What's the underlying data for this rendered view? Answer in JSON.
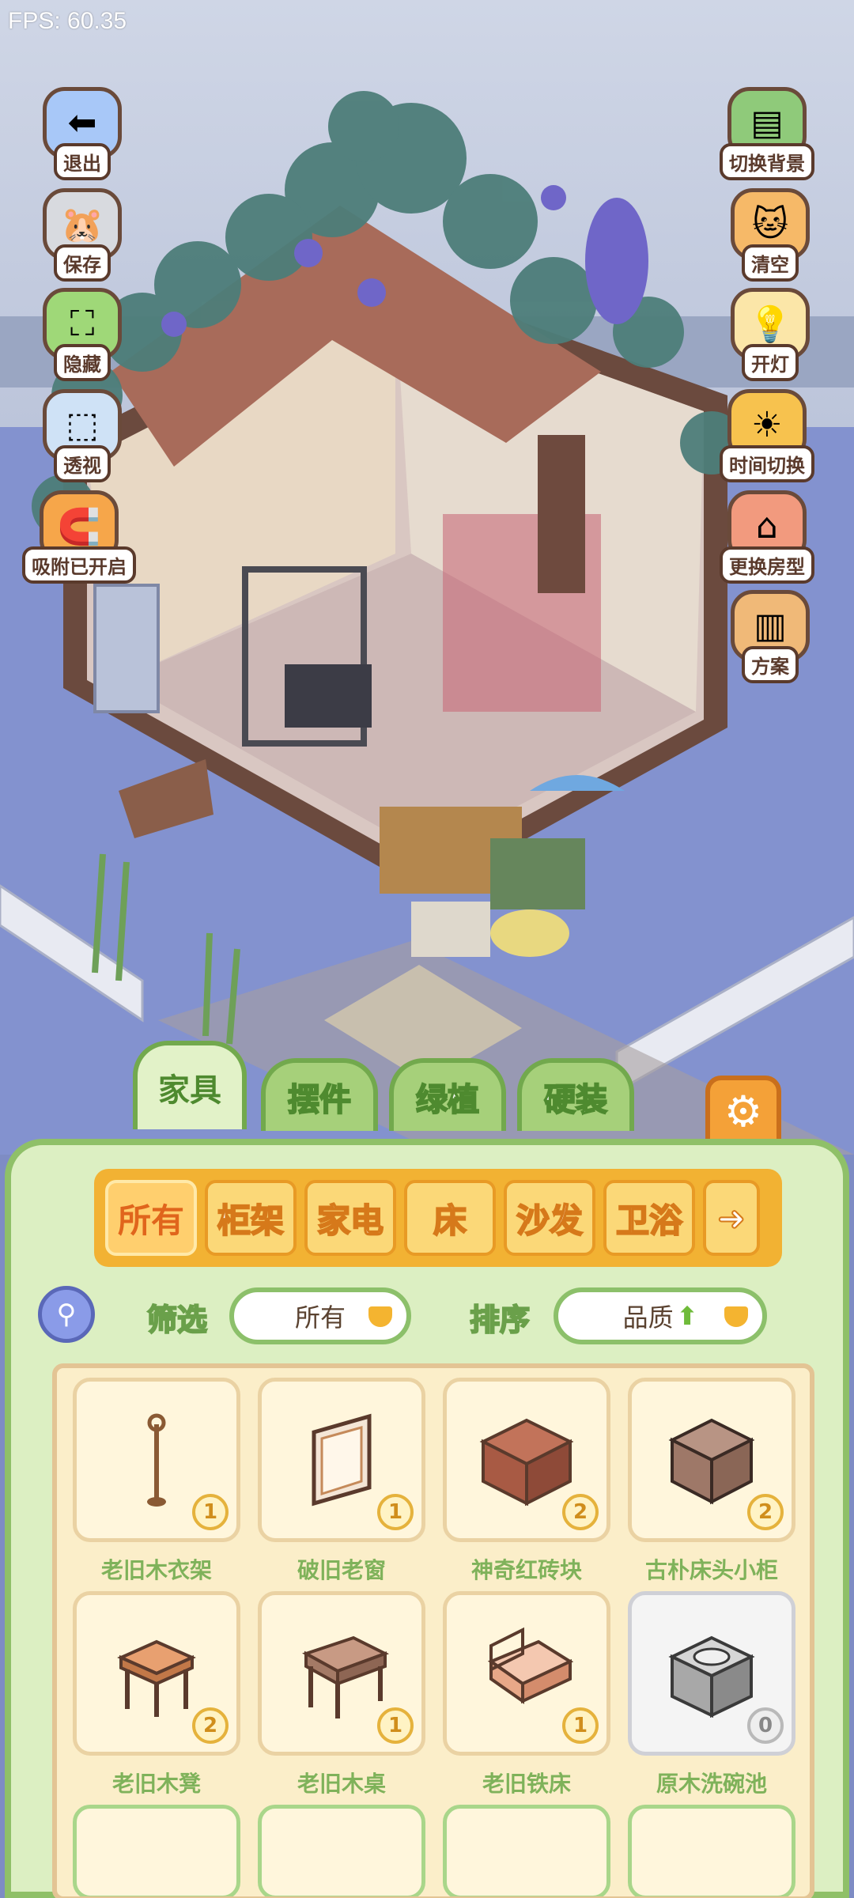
{
  "fps": "FPS: 60.35",
  "left_buttons": [
    {
      "label": "退出",
      "icon": "exit-arrow-icon"
    },
    {
      "label": "保存",
      "icon": "save-hamster-icon"
    },
    {
      "label": "隐藏",
      "icon": "hide-frame-icon"
    },
    {
      "label": "透视",
      "icon": "perspective-cube-icon"
    },
    {
      "label": "吸附已开启",
      "icon": "snap-magnet-icon"
    }
  ],
  "right_buttons": [
    {
      "label": "切换背景",
      "icon": "background-wallpaper-icon"
    },
    {
      "label": "清空",
      "icon": "clear-cat-icon"
    },
    {
      "label": "开灯",
      "icon": "light-bulb-icon"
    },
    {
      "label": "时间切换",
      "icon": "sun-moon-icon"
    },
    {
      "label": "更换房型",
      "icon": "house-icon"
    },
    {
      "label": "方案",
      "icon": "plan-folder-icon"
    }
  ],
  "main_tabs": [
    {
      "label": "家具",
      "active": true
    },
    {
      "label": "摆件",
      "active": false
    },
    {
      "label": "绿植",
      "active": false
    },
    {
      "label": "硬装",
      "active": false
    }
  ],
  "category_tabs": [
    {
      "label": "所有",
      "active": true
    },
    {
      "label": "柜架",
      "active": false
    },
    {
      "label": "家电",
      "active": false
    },
    {
      "label": "床",
      "active": false
    },
    {
      "label": "沙发",
      "active": false
    },
    {
      "label": "卫浴",
      "active": false
    }
  ],
  "filter": {
    "label": "筛选",
    "value": "所有"
  },
  "sort": {
    "label": "排序",
    "value": "品质",
    "arrow": "⬆"
  },
  "items": [
    {
      "name": "老旧木衣架",
      "count": "1",
      "icon": "coat-rack-icon"
    },
    {
      "name": "破旧老窗",
      "count": "1",
      "icon": "old-window-icon"
    },
    {
      "name": "神奇红砖块",
      "count": "2",
      "icon": "red-brick-icon"
    },
    {
      "name": "古朴床头小柜",
      "count": "2",
      "icon": "nightstand-icon"
    },
    {
      "name": "老旧木凳",
      "count": "2",
      "icon": "wooden-stool-icon"
    },
    {
      "name": "老旧木桌",
      "count": "1",
      "icon": "wooden-desk-icon"
    },
    {
      "name": "老旧铁床",
      "count": "1",
      "icon": "iron-bed-icon"
    },
    {
      "name": "原木洗碗池",
      "count": "0",
      "icon": "sink-cabinet-icon"
    }
  ],
  "colors": {
    "panel_bg": "#dcefc2",
    "tab_green": "#a6d07a",
    "category_orange": "#f2b233",
    "item_name_green": "#7fb25a",
    "count_gold": "#e5b23c"
  }
}
